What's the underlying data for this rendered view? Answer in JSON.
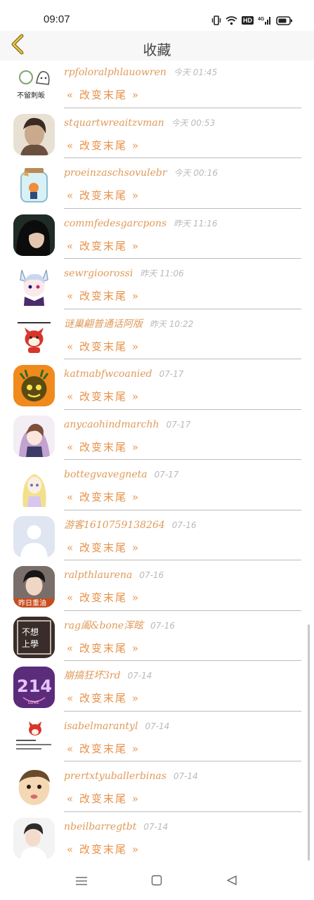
{
  "status_bar": {
    "time": "09:07",
    "network_label": "HD"
  },
  "header": {
    "title": "收藏",
    "back_icon": "chevron-left-icon",
    "accent_color": "#c9a227"
  },
  "message_text": "« 改变末尾 »",
  "items": [
    {
      "name": "rpfoloralphlauowren",
      "time": "今天 01:45",
      "message": "« 改变末尾 »",
      "avatar_caption": "不留刺皈"
    },
    {
      "name": "stquartwreaitzvman",
      "time": "今天 00:53",
      "message": "« 改变末尾 »",
      "avatar_caption": ""
    },
    {
      "name": "proeinzaschsovulebr",
      "time": "今天 00:16",
      "message": "« 改变末尾 »",
      "avatar_caption": ""
    },
    {
      "name": "commfedesgarcpons",
      "time": "昨天 11:16",
      "message": "« 改变末尾 »",
      "avatar_caption": ""
    },
    {
      "name": "sewrgioorossi",
      "time": "昨天 11:06",
      "message": "« 改变末尾 »",
      "avatar_caption": ""
    },
    {
      "name": "谜巢翩普通话阿版",
      "time": "昨天 10:22",
      "message": "« 改变末尾 »",
      "avatar_caption": ""
    },
    {
      "name": "katmabfwcoanied",
      "time": "07-17",
      "message": "« 改变末尾 »",
      "avatar_caption": ""
    },
    {
      "name": "anycaohindmarchh",
      "time": "07-17",
      "message": "« 改变末尾 »",
      "avatar_caption": ""
    },
    {
      "name": "bottegvavegneta",
      "time": "07-17",
      "message": "« 改变末尾 »",
      "avatar_caption": ""
    },
    {
      "name": "游客1610759138264",
      "time": "07-16",
      "message": "« 改变末尾 »",
      "avatar_caption": ""
    },
    {
      "name": "ralpthlaurena",
      "time": "07-16",
      "message": "« 改变末尾 »",
      "avatar_caption": "昨日重油"
    },
    {
      "name": "rag阖&bone浑眩",
      "time": "07-16",
      "message": "« 改变末尾 »",
      "avatar_caption": "不想上學"
    },
    {
      "name": "崩搞狂坏3rd",
      "time": "07-14",
      "message": "« 改变末尾 »",
      "avatar_caption": "214"
    },
    {
      "name": "isabelmarantyl",
      "time": "07-14",
      "message": "« 改变末尾 »",
      "avatar_caption": ""
    },
    {
      "name": "prertxtyuballerbinas",
      "time": "07-14",
      "message": "« 改变末尾 »",
      "avatar_caption": ""
    },
    {
      "name": "nbeilbarregtbt",
      "time": "07-14",
      "message": "« 改变末尾 »",
      "avatar_caption": ""
    }
  ],
  "nav": {
    "menu_icon": "menu-icon",
    "home_icon": "square-home-icon",
    "back_icon": "triangle-back-icon"
  }
}
